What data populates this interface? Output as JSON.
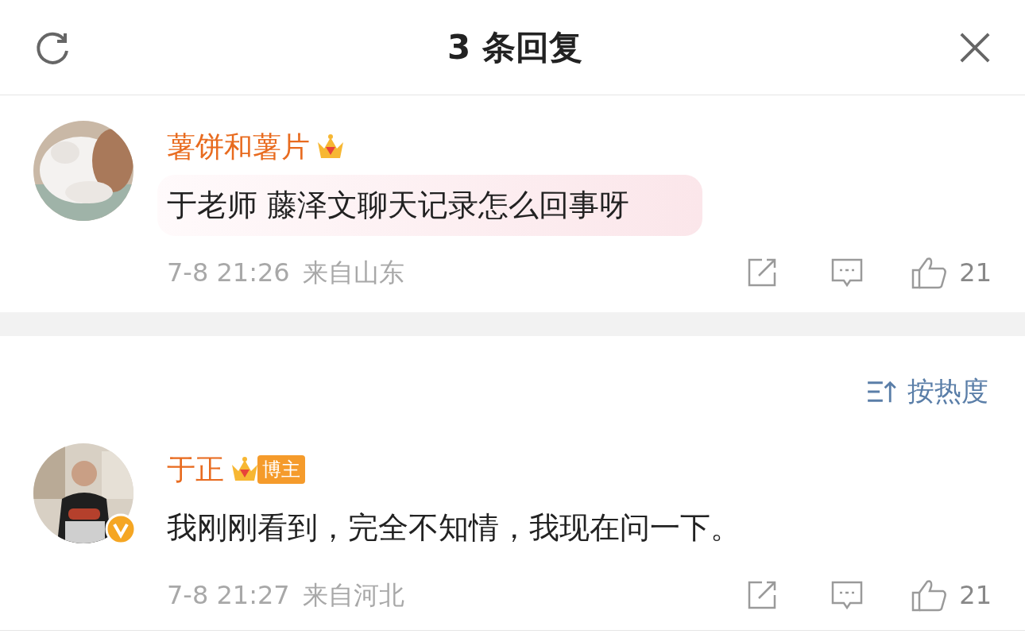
{
  "header": {
    "title": "3 条回复"
  },
  "root_comment": {
    "name": "薯饼和薯片",
    "text": "于老师 藤泽文聊天记录怎么回事呀",
    "time": "7-8 21:26",
    "location": "来自山东",
    "likes": "21",
    "highlighted": true,
    "verified": false
  },
  "sort": {
    "label": "按热度"
  },
  "replies": [
    {
      "name": "于正",
      "badge": "博主",
      "text": "我刚刚看到，完全不知情，我现在问一下。",
      "time": "7-8 21:27",
      "location": "来自河北",
      "likes": "21",
      "highlighted": false,
      "verified": true
    }
  ]
}
